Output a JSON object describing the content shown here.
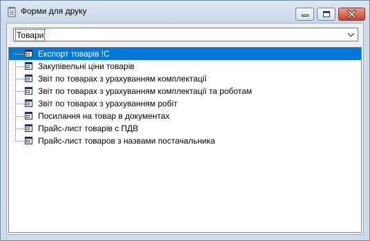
{
  "window": {
    "title": "Форми для друку",
    "icon": "document-list-icon",
    "controls": [
      "minimize-icon",
      "maximize-icon",
      "close-icon"
    ]
  },
  "category_select": {
    "value": "Товари",
    "icon": "chevron-down-icon"
  },
  "tree": {
    "item_icon": "report-form-icon",
    "selected_index": 0,
    "items": [
      {
        "label": "Експорт товарів !С"
      },
      {
        "label": "Закупівельні ціни товарів"
      },
      {
        "label": "Звіт по товарах з урахуванням комплектації"
      },
      {
        "label": "Звіт по товарах з урахуванням комплектації та роботам"
      },
      {
        "label": "Звіт по товарах з урахуванням робіт"
      },
      {
        "label": "Посилання на товар в документах"
      },
      {
        "label": "Прайс-лист товарів с ПДВ"
      },
      {
        "label": "Прайс-лист товаров з назвами постачальника"
      }
    ]
  },
  "colors": {
    "selection": "#0078d7",
    "frame": "#cfdbe9",
    "close_button": "#c8432a"
  }
}
